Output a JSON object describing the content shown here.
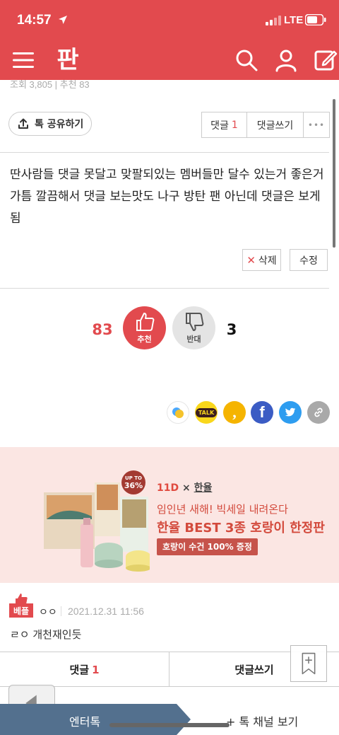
{
  "status": {
    "time": "14:57",
    "network": "LTE"
  },
  "nav": {
    "logo_text": "판"
  },
  "post_meta": {
    "text": "조회 3,805 | 추천 83"
  },
  "toolbar": {
    "share_label": "톡 공유하기",
    "comment_label": "댓글",
    "comment_count": "1",
    "write_label": "댓글쓰기",
    "more_label": "•••"
  },
  "comment": {
    "body": "딴사람들 댓글 못달고 맞팔되있는 멤버들만 달수 있는거 좋은거가틈 깔끔해서 댓글 보는맛도 나구 방탄 팬 아닌데 댓글은 보게됨",
    "delete_label": "삭제",
    "edit_label": "수정"
  },
  "vote": {
    "recommend_count": "83",
    "recommend_label": "추천",
    "oppose_label": "반대",
    "oppose_count": "3"
  },
  "share_icons": {
    "talk_label": "TALK",
    "story_label": ",",
    "facebook_label": "f",
    "icons": [
      "band-icon",
      "kakaotalk-icon",
      "kakaostory-icon",
      "facebook-icon",
      "twitter-icon",
      "link-icon"
    ]
  },
  "ad": {
    "brand_prefix": "11",
    "brand_x": "×",
    "brand_name": "한율",
    "badge_top": "UP TO",
    "badge_pct": "36%",
    "line1": "임인년 새해! 빅세일 내려온다",
    "line2": "한율 BEST 3종 호랑이 한정판",
    "promo": "호랑이 수건 100% 증정"
  },
  "reply": {
    "badge": "베플",
    "author": "ㅇㅇ",
    "date": "2021.12.31 11:56",
    "text": "ㄹㅇ 개천재인듯"
  },
  "bottom_bar": {
    "comment_label": "댓글",
    "comment_count": "1",
    "write_label": "댓글쓰기"
  },
  "footer": {
    "left_label": "엔터톡",
    "right_label": "+ 톡 채널 보기"
  },
  "colors": {
    "brand": "#e24a4e",
    "ad_bg": "#fbe6e3",
    "ad_text": "#d34a3c",
    "footer_tab": "#53708e"
  }
}
